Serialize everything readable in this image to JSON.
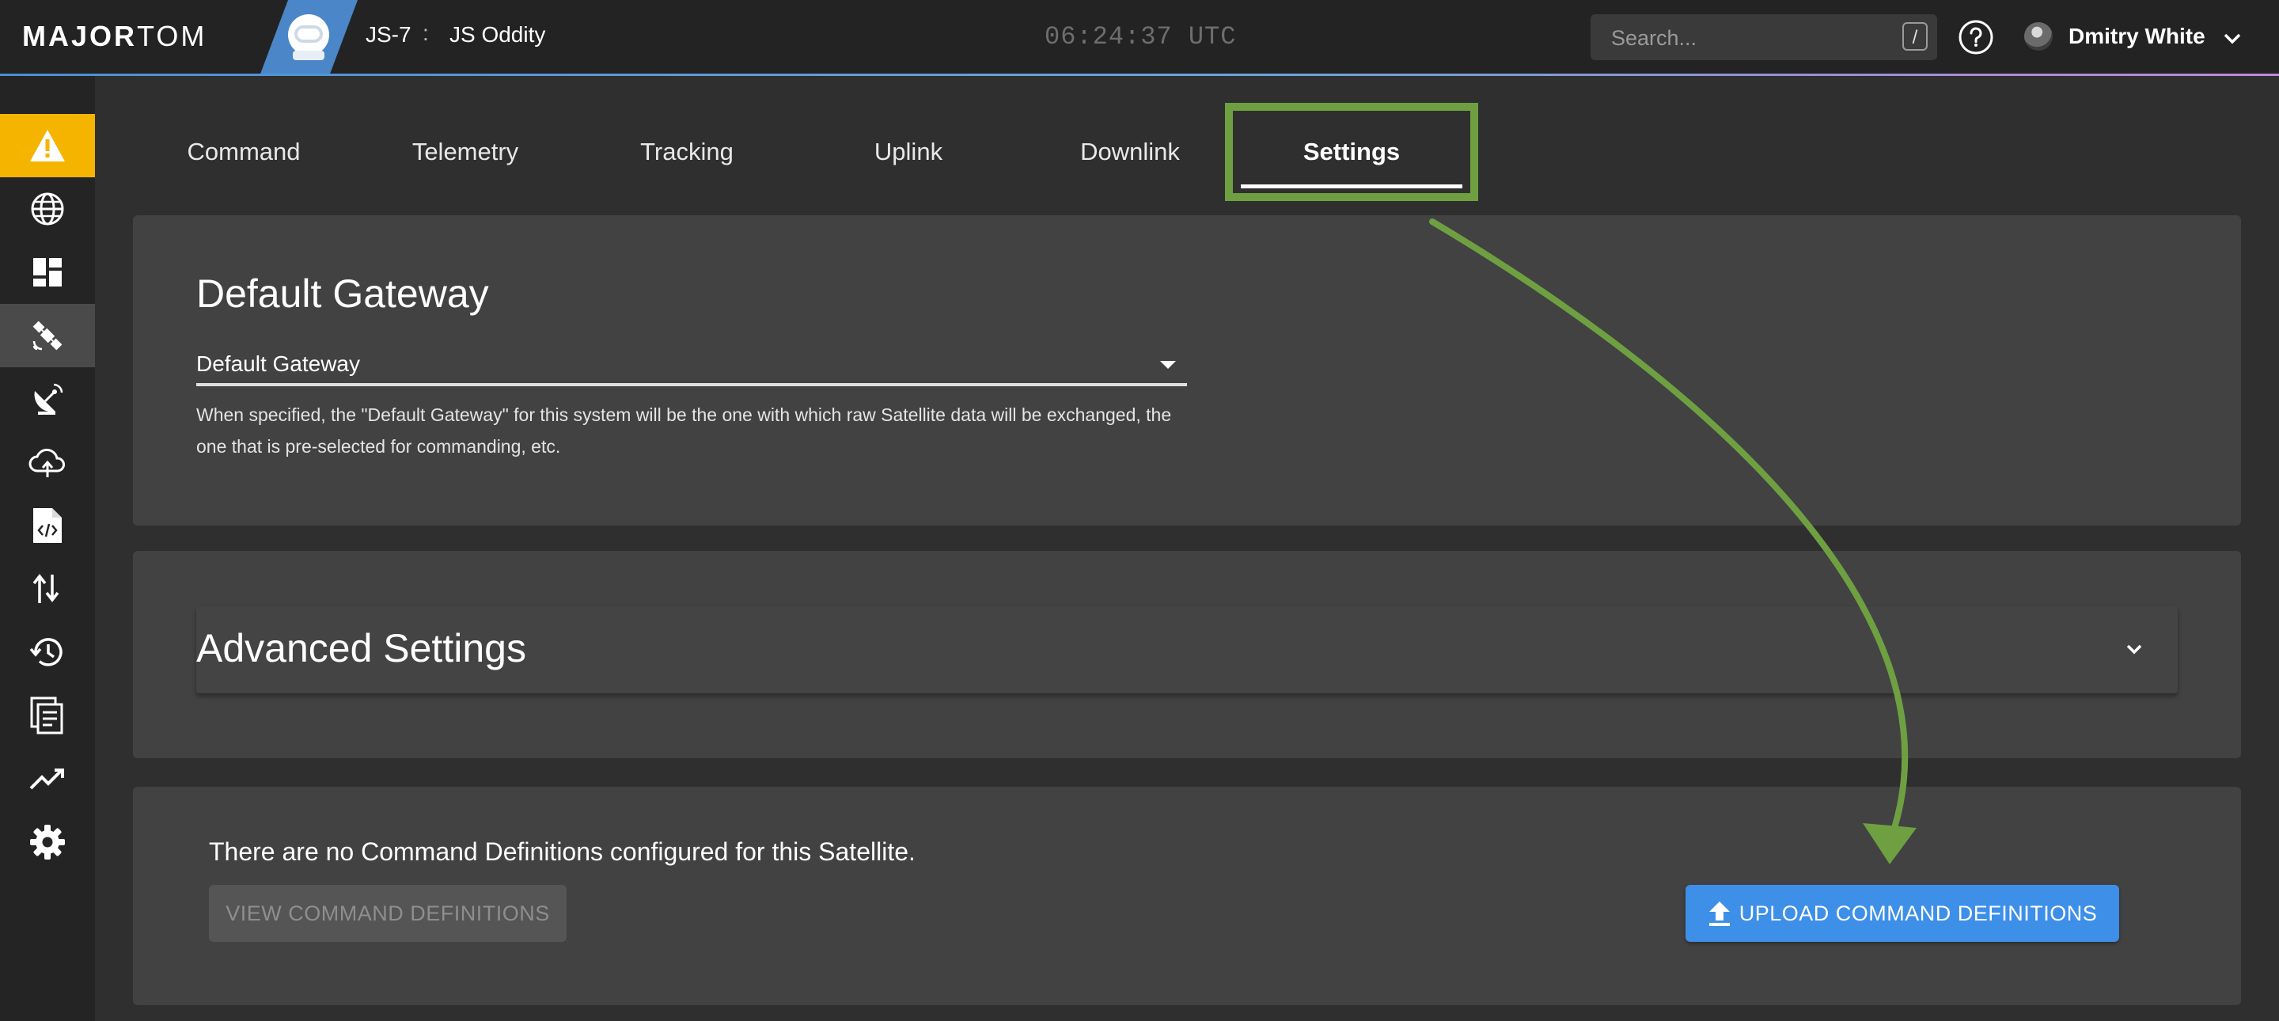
{
  "header": {
    "brand_bold": "MAJOR",
    "brand_light": "TOM",
    "satellite_id": "JS-7",
    "separator": ":",
    "satellite_name": "JS Oddity",
    "clock": "06:24:37 UTC",
    "search_placeholder": "Search...",
    "search_shortcut": "/",
    "user_name": "Dmitry White"
  },
  "sidebar": {
    "items": [
      {
        "icon": "warning-icon",
        "state": "alert"
      },
      {
        "icon": "globe-icon"
      },
      {
        "icon": "dashboard-icon"
      },
      {
        "icon": "satellite-icon",
        "state": "active"
      },
      {
        "icon": "satellite-dish-icon"
      },
      {
        "icon": "cloud-sync-icon"
      },
      {
        "icon": "code-file-icon"
      },
      {
        "icon": "transfer-arrows-icon"
      },
      {
        "icon": "history-icon"
      },
      {
        "icon": "documents-icon"
      },
      {
        "icon": "trending-chart-icon"
      },
      {
        "icon": "settings-gear-icon"
      }
    ]
  },
  "tabs": [
    {
      "label": "Command"
    },
    {
      "label": "Telemetry"
    },
    {
      "label": "Tracking"
    },
    {
      "label": "Uplink"
    },
    {
      "label": "Downlink"
    },
    {
      "label": "Settings",
      "selected": true
    }
  ],
  "gateway": {
    "title": "Default Gateway",
    "field_label": "Default Gateway",
    "help_text": "When specified, the \"Default Gateway\" for this system will be the one with which raw Satellite data will be exchanged, the one that is pre-selected for commanding, etc."
  },
  "advanced": {
    "title": "Advanced Settings"
  },
  "commands": {
    "message": "There are no Command Definitions configured for this Satellite.",
    "view_button": "VIEW COMMAND DEFINITIONS",
    "upload_button": "UPLOAD COMMAND DEFINITIONS"
  },
  "colors": {
    "alert": "#f4b400",
    "primary_button": "#3d8fe8",
    "annotation": "#6ea042",
    "satellite_tile": "#4a86c8"
  }
}
